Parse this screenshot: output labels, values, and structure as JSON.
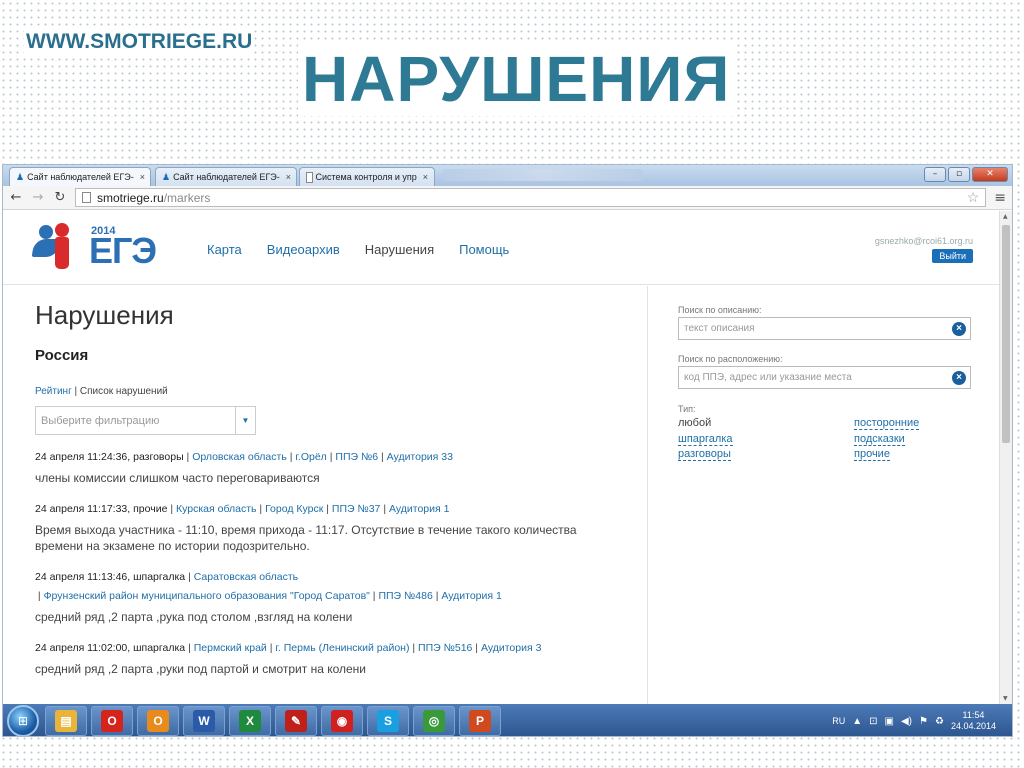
{
  "slide": {
    "site_url": "WWW.SMOTRIEGE.RU",
    "title": "НАРУШЕНИЯ"
  },
  "browser": {
    "tabs": [
      {
        "label": "Сайт наблюдателей ЕГЭ-",
        "icon": "ege-favicon",
        "active": true
      },
      {
        "label": "Сайт наблюдателей ЕГЭ-",
        "icon": "ege-favicon",
        "active": false
      },
      {
        "label": "Система контроля и упр",
        "icon": "page-icon",
        "active": false
      }
    ],
    "tab_close": "×",
    "url_host": "smotriege.ru",
    "url_path": "/markers",
    "window_controls": {
      "minimize": "–",
      "maximize": "▫",
      "close": "✕"
    }
  },
  "site": {
    "logo_year": "2014",
    "logo_text": "ЕГЭ",
    "nav": [
      "Карта",
      "Видеоархив",
      "Нарушения",
      "Помощь"
    ],
    "nav_current": "Нарушения",
    "user_email": "gsnezhko@rcoi61.org.ru",
    "logout_label": "Выйти"
  },
  "content": {
    "heading": "Нарушения",
    "region": "Россия",
    "view_rating": "Рейтинг",
    "view_sep": " | ",
    "view_list": "Список нарушений",
    "filter_placeholder": "Выберите фильтрацию",
    "reports": [
      {
        "meta": "24 апреля 11:24:36, разговоры",
        "links": [
          "Орловская область",
          "г.Орёл",
          "ППЭ №6",
          "Аудитория 33"
        ],
        "text": "члены комиссии слишком часто переговариваются"
      },
      {
        "meta": "24 апреля 11:17:33, прочие",
        "links": [
          "Курская область",
          "Город Курск",
          "ППЭ №37",
          "Аудитория 1"
        ],
        "text": "Время выхода участника - 11:10, время прихода - 11:17. Отсутствие в течение такого количества времени на экзамене по истории подозрительно."
      },
      {
        "meta": "24 апреля 11:13:46, шпаргалка",
        "links": [
          "Саратовская область"
        ],
        "links2": [
          "Фрунзенский район муниципального образования \"Город Саратов\"",
          "ППЭ №486",
          "Аудитория 1"
        ],
        "text": "средний ряд ,2 парта ,рука под столом ,взгляд на колени"
      },
      {
        "meta": "24 апреля 11:02:00, шпаргалка",
        "links": [
          "Пермский край",
          "г. Пермь (Ленинский район)",
          "ППЭ №516",
          "Аудитория 3"
        ],
        "text": "средний ряд ,2 парта ,руки под партой и смотрит на колени"
      }
    ]
  },
  "sidebar": {
    "search_desc_label": "Поиск по описанию:",
    "search_desc_placeholder": "текст описания",
    "search_loc_label": "Поиск по расположению:",
    "search_loc_placeholder": "код ППЭ, адрес или указание места",
    "clear_glyph": "×",
    "type_label": "Тип:",
    "types": [
      [
        "любой",
        "посторонние"
      ],
      [
        "шпаргалка",
        "подсказки"
      ],
      [
        "разговоры",
        "прочие"
      ]
    ]
  },
  "taskbar": {
    "apps": [
      {
        "name": "explorer",
        "glyph": "▤",
        "color": "#e8b53a"
      },
      {
        "name": "opera",
        "glyph": "O",
        "color": "#d4241c"
      },
      {
        "name": "outlook",
        "glyph": "O",
        "color": "#e88b1c"
      },
      {
        "name": "word",
        "glyph": "W",
        "color": "#2b5aa8"
      },
      {
        "name": "excel",
        "glyph": "X",
        "color": "#1f8a3e"
      },
      {
        "name": "acrobat",
        "glyph": "✎",
        "color": "#c0201a"
      },
      {
        "name": "app-red",
        "glyph": "◉",
        "color": "#d02020"
      },
      {
        "name": "skype",
        "glyph": "S",
        "color": "#1aa0e0"
      },
      {
        "name": "chrome",
        "glyph": "◎",
        "color": "#3a9a3a"
      },
      {
        "name": "powerpoint",
        "glyph": "P",
        "color": "#d04a1f"
      }
    ],
    "lang": "RU",
    "time": "11:54",
    "date": "24.04.2014"
  }
}
